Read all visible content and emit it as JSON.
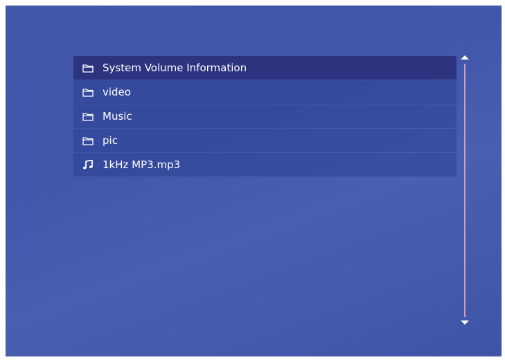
{
  "file_list": {
    "items": [
      {
        "label": "System Volume Information",
        "icon": "folder-icon",
        "selected": true
      },
      {
        "label": "video",
        "icon": "folder-icon",
        "selected": false
      },
      {
        "label": "Music",
        "icon": "folder-icon",
        "selected": false
      },
      {
        "label": "pic",
        "icon": "folder-icon",
        "selected": false
      },
      {
        "label": "1kHz MP3.mp3",
        "icon": "music-note-icon",
        "selected": false
      }
    ]
  },
  "colors": {
    "background": "#4257a8",
    "row": "#2f4496",
    "row_selected": "#2d327d",
    "text": "#ffffff",
    "scroll_track": "#d49ab8"
  },
  "scrollbar": {
    "up_icon": "arrow-up-icon",
    "down_icon": "arrow-down-icon"
  }
}
